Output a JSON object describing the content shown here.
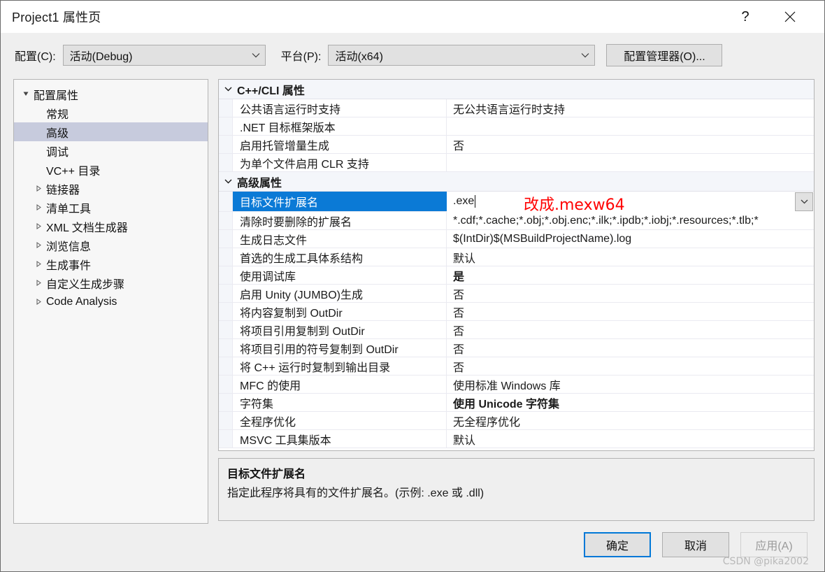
{
  "window": {
    "title": "Project1 属性页",
    "help_icon": "question-mark-icon",
    "close_icon": "close-icon"
  },
  "toolbar": {
    "config_label": "配置(C):",
    "config_value": "活动(Debug)",
    "platform_label": "平台(P):",
    "platform_value": "活动(x64)",
    "config_manager_label": "配置管理器(O)..."
  },
  "tree": {
    "items": [
      {
        "label": "配置属性",
        "indent": 0,
        "twisty": "expanded",
        "selected": false
      },
      {
        "label": "常规",
        "indent": 1,
        "twisty": "none",
        "selected": false
      },
      {
        "label": "高级",
        "indent": 1,
        "twisty": "none",
        "selected": true
      },
      {
        "label": "调试",
        "indent": 1,
        "twisty": "none",
        "selected": false
      },
      {
        "label": "VC++ 目录",
        "indent": 1,
        "twisty": "none",
        "selected": false
      },
      {
        "label": "链接器",
        "indent": 1,
        "twisty": "collapsed",
        "selected": false
      },
      {
        "label": "清单工具",
        "indent": 1,
        "twisty": "collapsed",
        "selected": false
      },
      {
        "label": "XML 文档生成器",
        "indent": 1,
        "twisty": "collapsed",
        "selected": false
      },
      {
        "label": "浏览信息",
        "indent": 1,
        "twisty": "collapsed",
        "selected": false
      },
      {
        "label": "生成事件",
        "indent": 1,
        "twisty": "collapsed",
        "selected": false
      },
      {
        "label": "自定义生成步骤",
        "indent": 1,
        "twisty": "collapsed",
        "selected": false
      },
      {
        "label": "Code Analysis",
        "indent": 1,
        "twisty": "collapsed",
        "selected": false
      }
    ]
  },
  "grid": {
    "groups": [
      {
        "name": "C++/CLI 属性",
        "chevron": "chevron-down-icon",
        "rows": [
          {
            "name": "公共语言运行时支持",
            "value": "无公共语言运行时支持",
            "bold": false
          },
          {
            "name": ".NET 目标框架版本",
            "value": "",
            "bold": false
          },
          {
            "name": "启用托管增量生成",
            "value": "否",
            "bold": false
          },
          {
            "name": "为单个文件启用 CLR 支持",
            "value": "",
            "bold": false
          }
        ]
      },
      {
        "name": "高级属性",
        "chevron": "chevron-down-icon",
        "rows": [
          {
            "name": "目标文件扩展名",
            "value": ".exe",
            "bold": false,
            "selected": true,
            "editing": true
          },
          {
            "name": "清除时要删除的扩展名",
            "value": "*.cdf;*.cache;*.obj;*.obj.enc;*.ilk;*.ipdb;*.iobj;*.resources;*.tlb;*",
            "bold": false
          },
          {
            "name": "生成日志文件",
            "value": "$(IntDir)$(MSBuildProjectName).log",
            "bold": false
          },
          {
            "name": "首选的生成工具体系结构",
            "value": "默认",
            "bold": false
          },
          {
            "name": "使用调试库",
            "value": "是",
            "bold": true
          },
          {
            "name": "启用 Unity (JUMBO)生成",
            "value": "否",
            "bold": false
          },
          {
            "name": "将内容复制到 OutDir",
            "value": "否",
            "bold": false
          },
          {
            "name": "将项目引用复制到 OutDir",
            "value": "否",
            "bold": false
          },
          {
            "name": "将项目引用的符号复制到 OutDir",
            "value": "否",
            "bold": false
          },
          {
            "name": "将 C++ 运行时复制到输出目录",
            "value": "否",
            "bold": false
          },
          {
            "name": "MFC 的使用",
            "value": "使用标准 Windows 库",
            "bold": false
          },
          {
            "name": "字符集",
            "value": "使用 Unicode 字符集",
            "bold": true
          },
          {
            "name": "全程序优化",
            "value": "无全程序优化",
            "bold": false
          },
          {
            "name": "MSVC 工具集版本",
            "value": "默认",
            "bold": false
          }
        ]
      }
    ],
    "annotation": "改成.mexw64",
    "annotation_color": "#ff0000",
    "selection_color": "#0b7ad6"
  },
  "description": {
    "title": "目标文件扩展名",
    "body": "指定此程序将具有的文件扩展名。(示例: .exe 或 .dll)"
  },
  "footer": {
    "ok_label": "确定",
    "cancel_label": "取消",
    "apply_label": "应用(A)",
    "apply_disabled": true
  },
  "watermark": "CSDN @pika2002"
}
